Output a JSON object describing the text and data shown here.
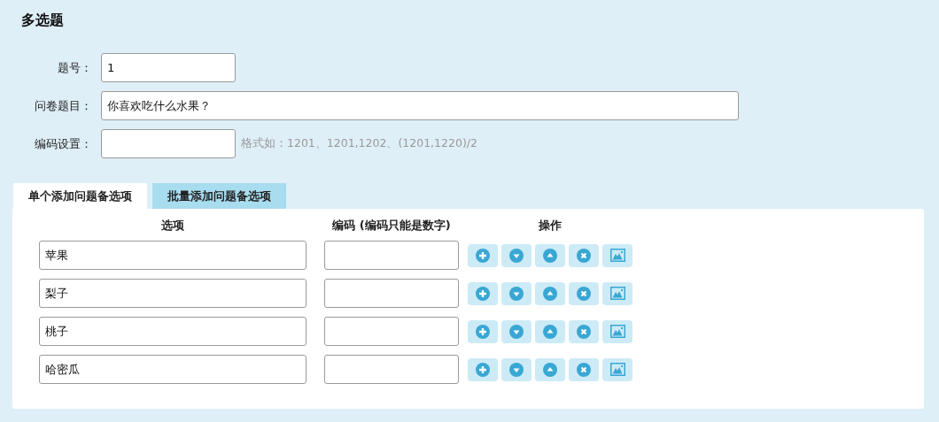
{
  "title": "多选题",
  "fields": [
    {
      "label": "题号：",
      "value": "1"
    },
    {
      "label": "问卷题目：",
      "value": "你喜欢吃什么水果？"
    },
    {
      "label": "编码设置：",
      "hint": "格式如：1201、1201,1202、(1201,1220)/2"
    }
  ],
  "tabs": [
    {
      "label": "单个添加问题备选项",
      "selected": true
    },
    {
      "label": "批量添加问题备选项",
      "selected": false
    }
  ],
  "columns": [
    "选项",
    "编码 (编码只能是数字)",
    "操作"
  ],
  "rows": [
    {
      "option": "苹果"
    },
    {
      "option": "梨子"
    },
    {
      "option": "桃子"
    },
    {
      "option": "哈密瓜"
    }
  ]
}
